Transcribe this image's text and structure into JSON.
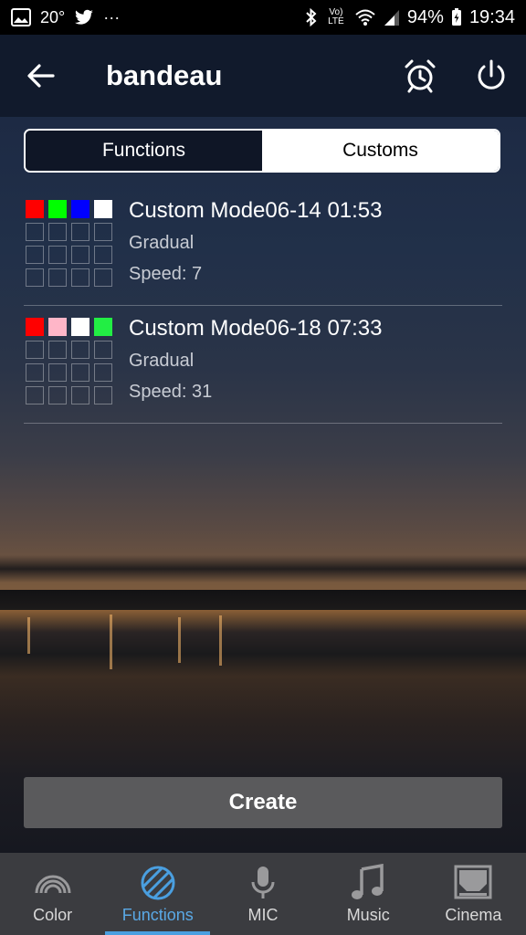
{
  "status_bar": {
    "temperature": "20°",
    "dots": "···",
    "battery": "94%",
    "time": "19:34",
    "network": "Vo) LTE"
  },
  "app_bar": {
    "title": "bandeau"
  },
  "segmented": {
    "tabs": [
      {
        "label": "Functions",
        "active": false
      },
      {
        "label": "Customs",
        "active": true
      }
    ]
  },
  "customs": [
    {
      "name": "Custom Mode06-14 01:53",
      "mode": "Gradual",
      "speed": "Speed: 7",
      "colors": [
        "#ff0000",
        "#00ff00",
        "#0000ff",
        "#ffffff"
      ]
    },
    {
      "name": "Custom Mode06-18 07:33",
      "mode": "Gradual",
      "speed": "Speed: 31",
      "colors": [
        "#ff0000",
        "#ffb6c8",
        "#ffffff",
        "#22ee44"
      ]
    }
  ],
  "create_label": "Create",
  "bottom_nav": [
    {
      "label": "Color",
      "icon": "rainbow-icon",
      "active": false
    },
    {
      "label": "Functions",
      "icon": "functions-icon",
      "active": true
    },
    {
      "label": "MIC",
      "icon": "microphone-icon",
      "active": false
    },
    {
      "label": "Music",
      "icon": "music-note-icon",
      "active": false
    },
    {
      "label": "Cinema",
      "icon": "cinema-icon",
      "active": false
    }
  ],
  "colors": {
    "accent": "#4a9fe0",
    "app_bar": "#111a2c",
    "nav_bg": "#3b3c40"
  }
}
